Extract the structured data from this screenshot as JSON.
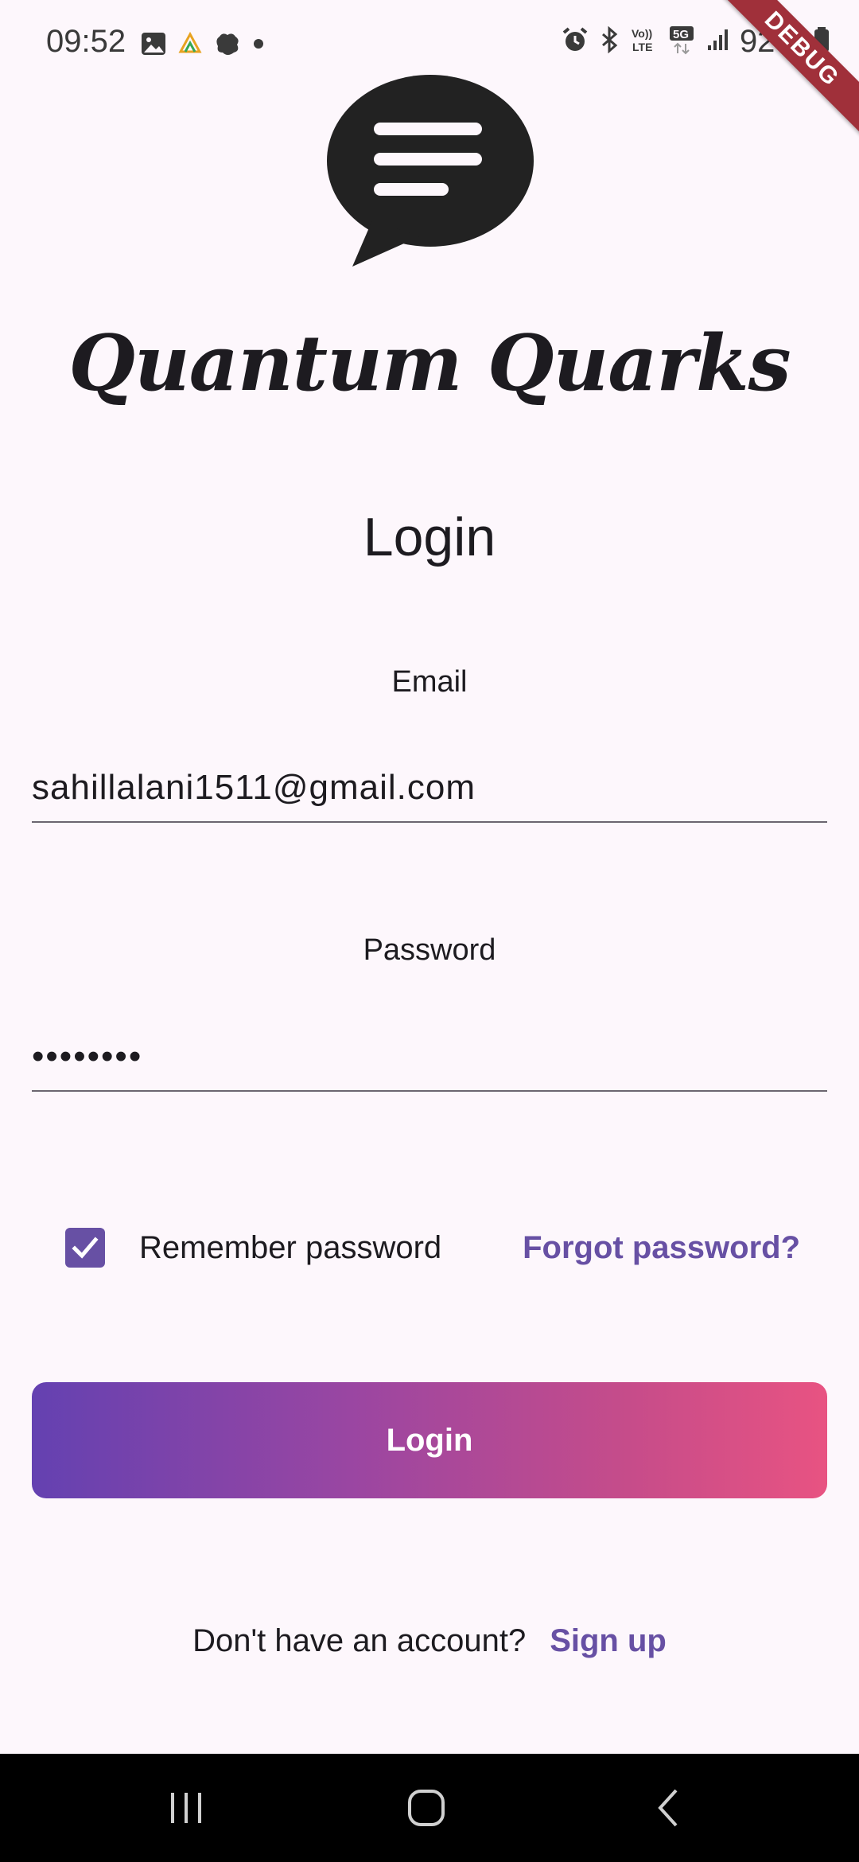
{
  "status_bar": {
    "time": "09:52",
    "battery": "92%",
    "debug_banner": "DEBUG",
    "icons": [
      "image-icon",
      "drive-icon",
      "settings-blob-icon",
      "dot-icon",
      "alarm-icon",
      "bluetooth-icon",
      "volte-icon",
      "5g-icon",
      "signal-icon",
      "battery-icon"
    ]
  },
  "app": {
    "logo_icon": "chat-bubble-icon",
    "title": "Quantum Quarks"
  },
  "form": {
    "heading": "Login",
    "email": {
      "label": "Email",
      "value": "sahillalani1511@gmail.com"
    },
    "password": {
      "label": "Password",
      "value": "••••••••"
    },
    "remember": {
      "label": "Remember password",
      "checked": true
    },
    "forgot_label": "Forgot password?",
    "login_label": "Login",
    "signup_prompt": "Don't have an account?",
    "signup_label": "Sign up"
  },
  "nav_bar": {
    "items": [
      "recent-apps-icon",
      "home-icon",
      "back-icon"
    ]
  },
  "colors": {
    "accent": "#6750a4",
    "background": "#fdf7fc",
    "gradient_start": "#6441b1",
    "gradient_end": "#e85382"
  }
}
